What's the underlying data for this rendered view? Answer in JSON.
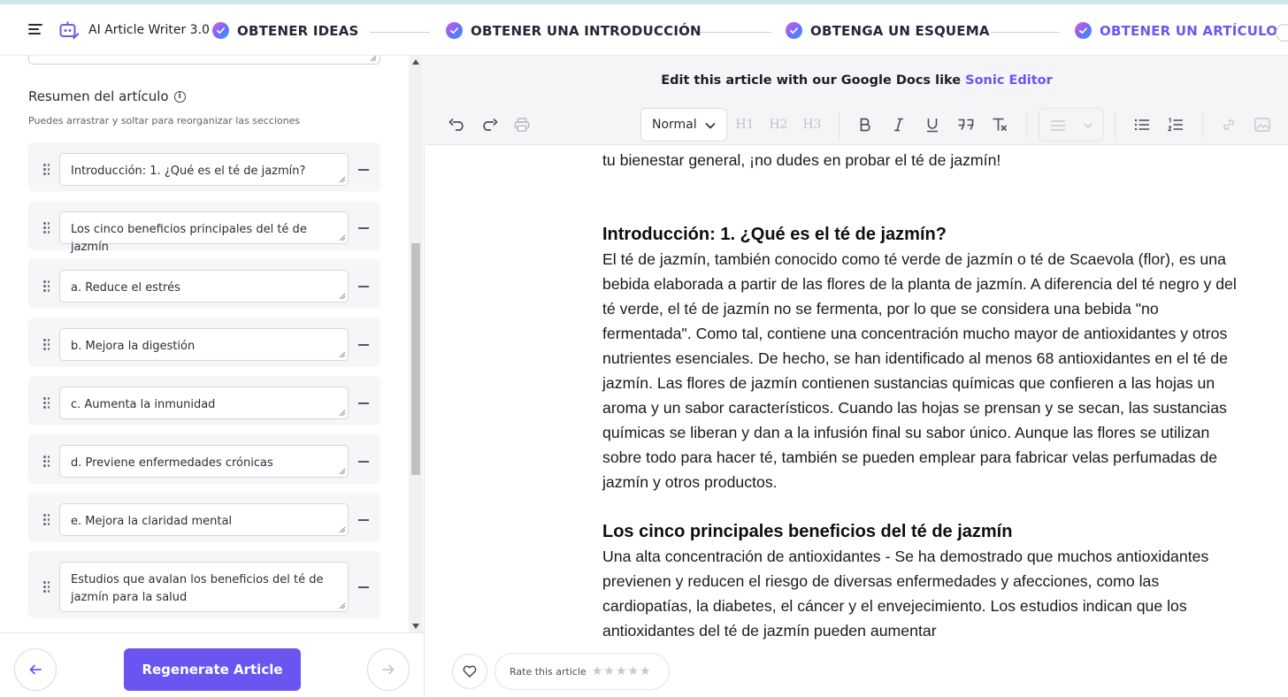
{
  "header": {
    "app_title": "AI Article Writer 3.0",
    "steps": [
      {
        "label": "OBTENER IDEAS",
        "active": false
      },
      {
        "label": "OBTENER UNA INTRODUCCIÓN",
        "active": false
      },
      {
        "label": "OBTENGA UN ESQUEMA",
        "active": false
      },
      {
        "label": "OBTENER UN ARTÍCULO",
        "active": true
      }
    ]
  },
  "left_panel": {
    "summary_title": "Resumen del artículo",
    "summary_subtitle": "Puedes arrastrar y soltar para reorganizar las secciones",
    "sections": [
      "Introducción: 1. ¿Qué es el té de jazmín?",
      "Los cinco beneficios principales del té de jazmín",
      "a. Reduce el estrés",
      "b. Mejora la digestión",
      "c. Aumenta la inmunidad",
      "d. Previene enfermedades crónicas",
      "e. Mejora la claridad mental",
      "Estudios que avalan los beneficios del té de jazmín para la salud"
    ],
    "regenerate_label": "Regenerate Article"
  },
  "editor": {
    "banner_text": "Edit this article with our Google Docs like",
    "banner_link": "Sonic Editor",
    "format_value": "Normal",
    "heading_buttons": [
      "H1",
      "H2",
      "H3"
    ],
    "content": {
      "intro_tail": "tu bienestar general, ¡no dudes en probar el té de jazmín!",
      "h1": "Introducción: 1. ¿Qué es el té de jazmín?",
      "p1": "El té de jazmín, también conocido como té verde de jazmín o té de Scaevola (flor), es una bebida elaborada a partir de las flores de la planta de jazmín. A diferencia del té negro y del té verde, el té de jazmín no se fermenta, por lo que se considera una bebida \"no fermentada\". Como tal, contiene una concentración mucho mayor de antioxidantes y otros nutrientes esenciales. De hecho, se han identificado al menos 68 antioxidantes en el té de jazmín. Las flores de jazmín contienen sustancias químicas que confieren a las hojas un aroma y un sabor característicos. Cuando las hojas se prensan y se secan, las sustancias químicas se liberan y dan a la infusión final su sabor único. Aunque las flores se utilizan sobre todo para hacer té, también se pueden emplear para fabricar velas perfumadas de jazmín y otros productos.",
      "h2": "Los cinco principales beneficios del té de jazmín",
      "p2": "Una alta concentración de antioxidantes - Se ha demostrado que muchos antioxidantes previenen y reducen el riesgo de diversas enfermedades y afecciones, como las cardiopatías, la diabetes, el cáncer y el envejecimiento. Los estudios indican que los antioxidantes del té de jazmín pueden aumentar"
    },
    "rate_label": "Rate this article",
    "rating_stars": 5
  },
  "colors": {
    "accent": "#6a55f1",
    "active_step": "#7054f5",
    "banner_bg": "#f5f5f7"
  }
}
